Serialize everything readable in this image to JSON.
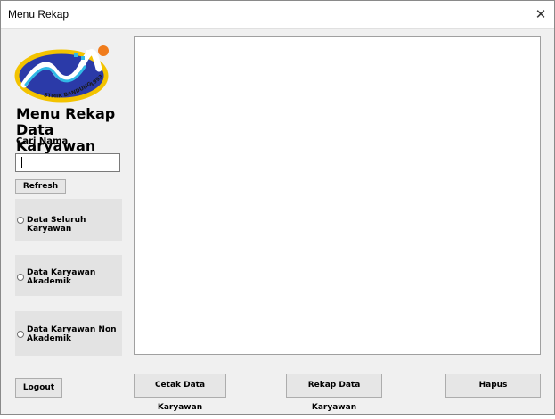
{
  "window": {
    "title": "Menu Rekap",
    "close_symbol": "✕"
  },
  "logo": {
    "text": "STMIK BANDUNG",
    "year": "1993"
  },
  "sidebar": {
    "heading": "Menu Rekap Data Karyawan",
    "search_label": "Cari Nama",
    "search_value": "",
    "refresh_label": "Refresh",
    "options": [
      {
        "label": "Data Seluruh Karyawan",
        "selected": false
      },
      {
        "label": "Data Karyawan Akademik",
        "selected": false
      },
      {
        "label": "Data Karyawan Non Akademik",
        "selected": false
      }
    ],
    "logout_label": "Logout"
  },
  "actions": {
    "cetak_label": "Cetak Data Karyawan",
    "rekap_label": "Rekap Data Karyawan",
    "hapus_label": "Hapus"
  }
}
